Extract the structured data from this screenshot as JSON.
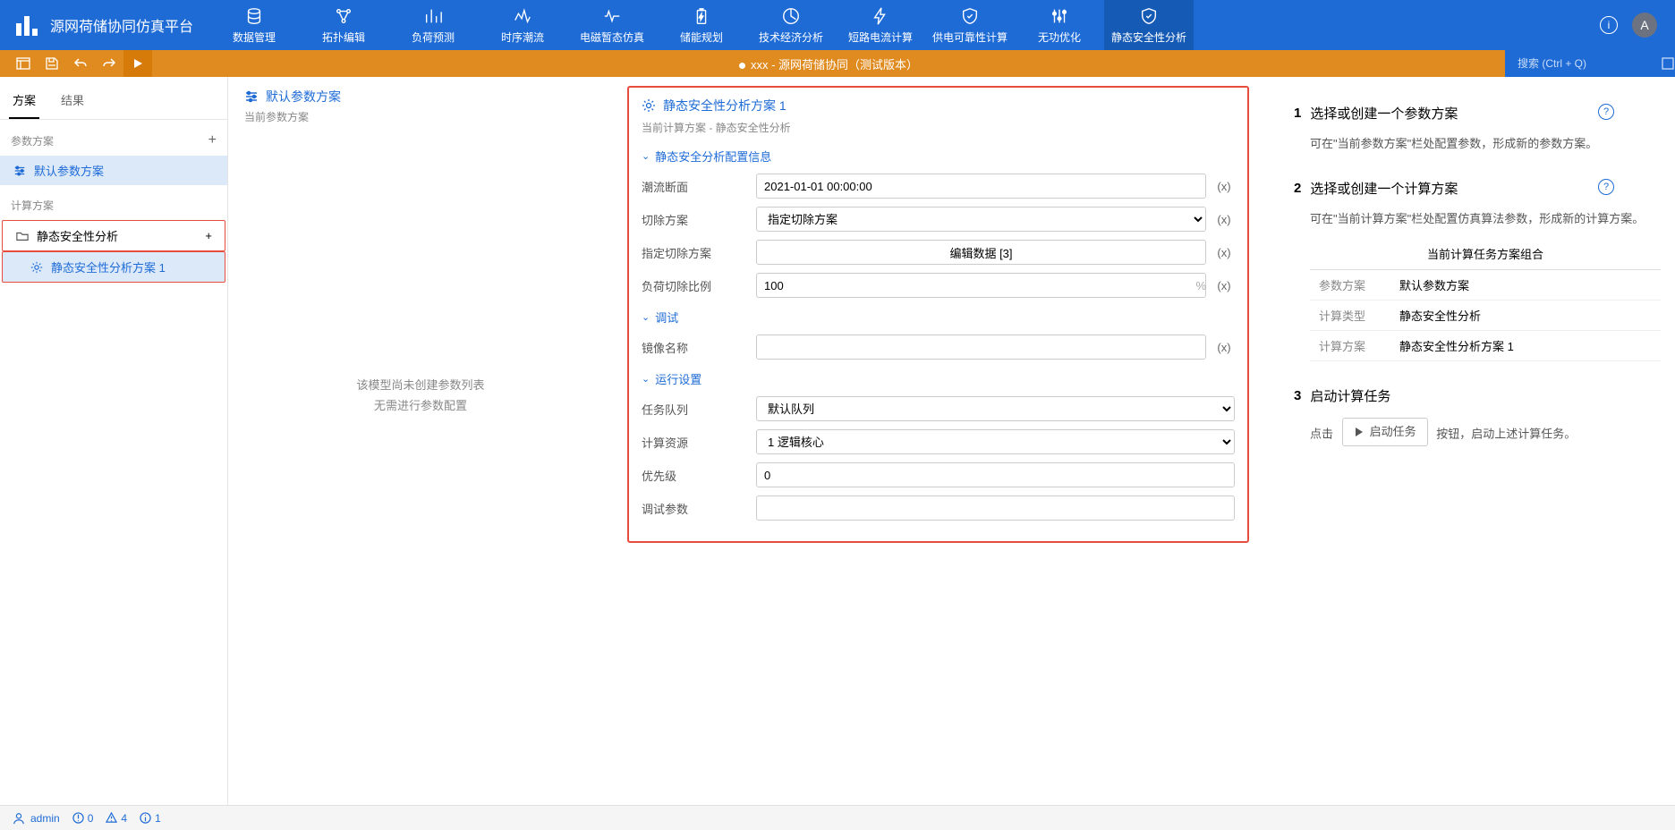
{
  "app": {
    "title": "源网荷储协同仿真平台"
  },
  "nav": {
    "items": [
      {
        "label": "数据管理"
      },
      {
        "label": "拓扑编辑"
      },
      {
        "label": "负荷预测"
      },
      {
        "label": "时序潮流"
      },
      {
        "label": "电磁暂态仿真"
      },
      {
        "label": "储能规划"
      },
      {
        "label": "技术经济分析"
      },
      {
        "label": "短路电流计算"
      },
      {
        "label": "供电可靠性计算"
      },
      {
        "label": "无功优化"
      },
      {
        "label": "静态安全性分析"
      }
    ],
    "active_index": 10,
    "avatar_letter": "A"
  },
  "toolbar": {
    "doc_title": "xxx - 源网荷储协同（测试版本）",
    "search_placeholder": "搜索 (Ctrl + Q)"
  },
  "sidebar": {
    "tabs": [
      {
        "label": "方案"
      },
      {
        "label": "结果"
      }
    ],
    "active_tab": 0,
    "section_params": "参数方案",
    "default_params": "默认参数方案",
    "section_calc": "计算方案",
    "calc_group": "静态安全性分析",
    "calc_item": "静态安全性分析方案 1"
  },
  "col1": {
    "title": "默认参数方案",
    "subtitle": "当前参数方案",
    "empty_l1": "该模型尚未创建参数列表",
    "empty_l2": "无需进行参数配置"
  },
  "config": {
    "title": "静态安全性分析方案 1",
    "subtitle": "当前计算方案 - 静态安全性分析",
    "groups": {
      "g1": "静态安全分析配置信息",
      "g2": "调试",
      "g3": "运行设置"
    },
    "fields": {
      "flow_section": {
        "label": "潮流断面",
        "value": "2021-01-01 00:00:00"
      },
      "cut_scheme": {
        "label": "切除方案",
        "value": "指定切除方案"
      },
      "spec_cut": {
        "label": "指定切除方案",
        "value": "编辑数据 [3]"
      },
      "load_ratio": {
        "label": "负荷切除比例",
        "value": "100",
        "unit": "%"
      },
      "image_name": {
        "label": "镜像名称",
        "value": ""
      },
      "queue": {
        "label": "任务队列",
        "value": "默认队列"
      },
      "cores": {
        "label": "计算资源",
        "value": "1 逻辑核心"
      },
      "priority": {
        "label": "优先级",
        "value": "0"
      },
      "debug_args": {
        "label": "调试参数",
        "value": ""
      }
    },
    "reset": "(x)"
  },
  "guide": {
    "s1": {
      "num": "1",
      "title": "选择或创建一个参数方案",
      "desc": "可在\"当前参数方案\"栏处配置参数，形成新的参数方案。"
    },
    "s2": {
      "num": "2",
      "title": "选择或创建一个计算方案",
      "desc": "可在\"当前计算方案\"栏处配置仿真算法参数，形成新的计算方案。"
    },
    "table": {
      "caption": "当前计算任务方案组合",
      "rows": [
        {
          "k": "参数方案",
          "v": "默认参数方案"
        },
        {
          "k": "计算类型",
          "v": "静态安全性分析"
        },
        {
          "k": "计算方案",
          "v": "静态安全性分析方案 1"
        }
      ]
    },
    "s3": {
      "num": "3",
      "title": "启动计算任务",
      "pre": "点击",
      "btn": "启动任务",
      "post": "按钮，启动上述计算任务。"
    }
  },
  "status": {
    "user": "admin",
    "errors": "0",
    "warnings": "4",
    "infos": "1"
  }
}
